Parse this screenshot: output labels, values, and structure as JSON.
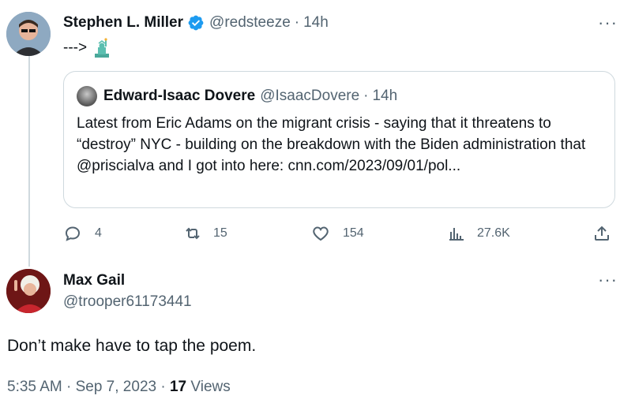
{
  "main_tweet": {
    "name": "Stephen L. Miller",
    "handle": "@redsteeze",
    "dot": "·",
    "time": "14h",
    "text": "--->",
    "statue_icon": "statue-of-liberty-icon"
  },
  "quoted_tweet": {
    "name": "Edward-Isaac Dovere",
    "handle": "@IsaacDovere",
    "dot": "·",
    "time": "14h",
    "text": "Latest from Eric Adams on the migrant crisis - saying that it threatens to “destroy” NYC - building on the breakdown with the Biden administration that @priscialva and I got into here: cnn.com/2023/09/01/pol..."
  },
  "actions": {
    "reply_count": "4",
    "retweet_count": "15",
    "like_count": "154",
    "views_count": "27.6K"
  },
  "reply": {
    "name": "Max Gail",
    "handle": "@trooper61173441",
    "text": "Don’t make have to tap the poem.",
    "timestamp": "5:35 AM · Sep 7, 2023 · ",
    "views_count": "17",
    "views_label": "Views"
  },
  "more_label": "···",
  "colors": {
    "verified": "#1d9bf0",
    "muted": "#536471",
    "border": "#cfd9de",
    "text": "#0f1419"
  }
}
